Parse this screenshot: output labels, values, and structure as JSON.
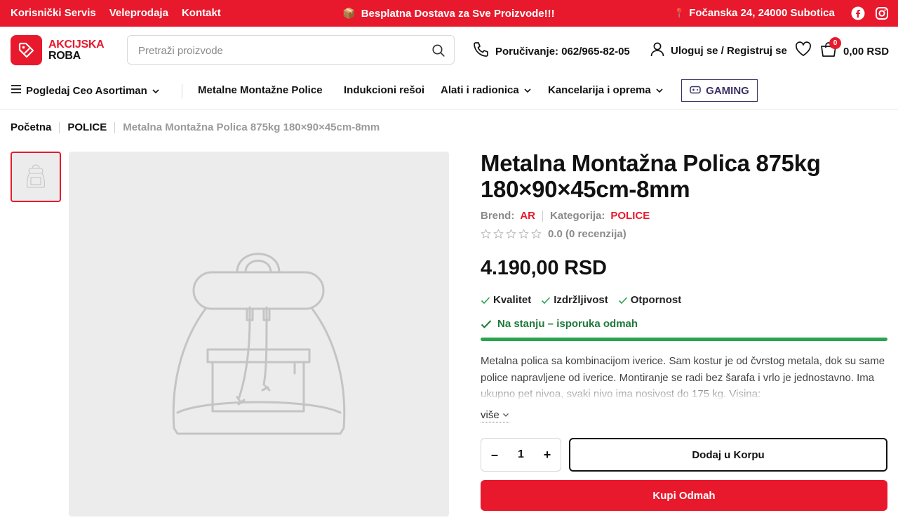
{
  "topbar": {
    "links": [
      "Korisnički Servis",
      "Veleprodaja",
      "Kontakt"
    ],
    "promo": "Besplatna Dostava za Sve Proizvode!!!",
    "promo_icon": "📦",
    "address": "Fočanska 24, 24000 Subotica",
    "address_icon": "📍",
    "social_icons": [
      "facebook-icon",
      "instagram-icon"
    ],
    "bg_color": "#e8192c"
  },
  "header": {
    "logo_line1": "AKCIJSKA",
    "logo_line2": "ROBA",
    "search_placeholder": "Pretraži proizvode",
    "phone_label": "Poručivanje: 062/965-82-05",
    "account_label": "Uloguj se / Registruj se",
    "cart_count": "0",
    "cart_total": "0,00 RSD"
  },
  "nav": {
    "all_products": "Pogledaj Ceo Asortiman",
    "items": [
      "Metalne Montažne Police",
      "Indukcioni rešoi",
      "Alati i radionica",
      "Kancelarija i oprema"
    ],
    "gaming": "GAMING"
  },
  "breadcrumb": {
    "home": "Početna",
    "category": "POLICE",
    "current": "Metalna Montažna Polica 875kg 180×90×45cm-8mm"
  },
  "product": {
    "title": "Metalna Montažna Polica 875kg 180×90×45cm-8mm",
    "brand_label": "Brend:",
    "brand": "AR",
    "category_label": "Kategorija:",
    "category": "POLICE",
    "rating_stars": 0,
    "rating_text": "0.0 (0 recenzija)",
    "price": "4.190,00 RSD",
    "features": [
      "Kvalitet",
      "Izdržljivost",
      "Otpornost"
    ],
    "stock": "Na stanju – isporuka odmah",
    "description": "Metalna polica sa kombinacijom iverice. Sam kostur je od čvrstog metala, dok su same police napravljene od iverice. Montiranje se radi bez šarafa i vrlo je jednostavno. Ima ukupno pet nivoa, svaki nivo ima nosivost do 175 kg. Visina:",
    "more": "više",
    "quantity": "1",
    "qty_minus": "–",
    "qty_plus": "+",
    "add_to_cart": "Dodaj u Korpu",
    "buy_now": "Kupi Odmah",
    "placeholder_image": "backpack-placeholder-icon"
  }
}
